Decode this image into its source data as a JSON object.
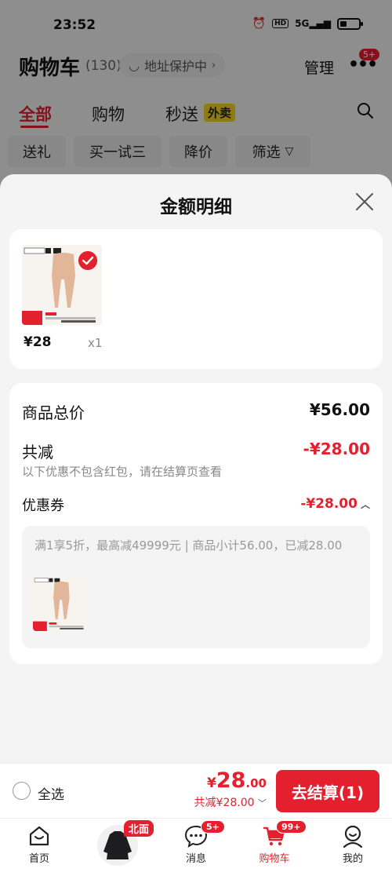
{
  "status_bar": {
    "time": "23:52",
    "hd_label": "HD",
    "network_label": "5G"
  },
  "header": {
    "title": "购物车",
    "count": "(130)",
    "address_status": "地址保护中",
    "manage_label": "管理",
    "more_badge": "5+"
  },
  "tabs": [
    {
      "label": "全部",
      "active": true
    },
    {
      "label": "购物",
      "active": false
    },
    {
      "label": "秒送",
      "active": false
    }
  ],
  "takeaway_badge": "外卖",
  "chips": [
    "送礼",
    "买一试三",
    "降价",
    "筛选"
  ],
  "sheet": {
    "title": "金额明细",
    "product": {
      "price": "¥28",
      "quantity": "x1"
    },
    "summary": {
      "total_label": "商品总价",
      "total_value": "¥56.00",
      "discount_label": "共减",
      "discount_value": "-¥28.00",
      "note": "以下优惠不包含红包，请在结算页查看",
      "coupon_label": "优惠券",
      "coupon_value": "-¥28.00",
      "coupon_desc": "满1享5折，最高减49999元 | 商品小计56.00，已减28.00"
    }
  },
  "checkout": {
    "select_all": "全选",
    "currency": "¥",
    "price_int": "28",
    "price_dec": ".00",
    "savings": "共减¥28.00",
    "button": "去结算(1)"
  },
  "tabbar": {
    "home": "首页",
    "promo_badge": "北面",
    "messages": "消息",
    "messages_badge": "5+",
    "cart": "购物车",
    "cart_badge": "99+",
    "mine": "我的"
  },
  "colors": {
    "accent": "#e5202e",
    "takeaway": "#f7d51d"
  }
}
